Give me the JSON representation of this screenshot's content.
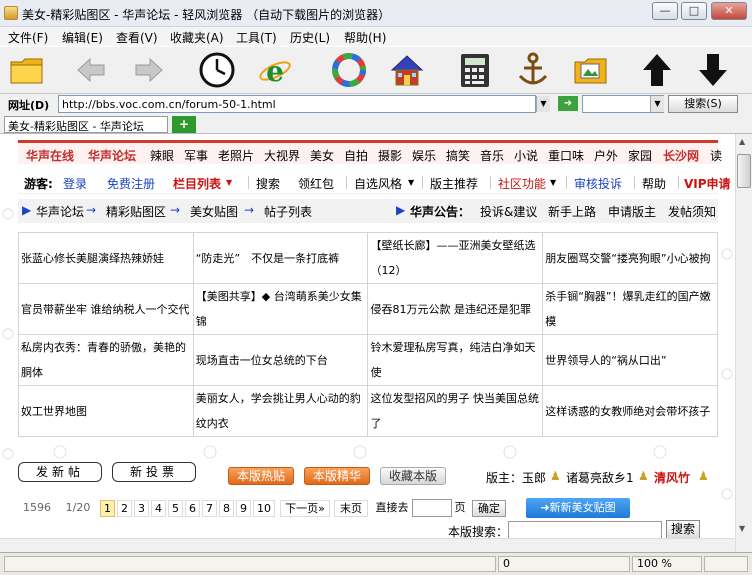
{
  "window": {
    "title": "美女-精彩贴图区 - 华声论坛 - 轻风浏览器 （自动下载图片的浏览器）",
    "controls": {
      "minimize": "—",
      "maximize": "□",
      "close": "✕"
    }
  },
  "menu": [
    "文件(F)",
    "编辑(E)",
    "查看(V)",
    "收藏夹(A)",
    "工具(T)",
    "历史(L)",
    "帮助(H)"
  ],
  "toolbar": {
    "buttons": [
      "folder-icon",
      "back-icon",
      "forward-icon",
      "clock-icon",
      "ie-icon",
      "refresh-ring-icon",
      "home-icon",
      "calculator-icon",
      "anchor-icon",
      "picture-folder-icon",
      "up-arrow-icon",
      "down-arrow-icon"
    ]
  },
  "address": {
    "label": "网址(D)",
    "url": "http://bbs.voc.com.cn/forum-50-1.html",
    "go": "➜",
    "search_button": "搜索(S)"
  },
  "tabs": {
    "active": "美女-精彩贴图区 - 华声论坛",
    "new_tab": "+"
  },
  "site_nav": [
    "华声在线",
    "华声论坛",
    "辣眼",
    "军事",
    "老照片",
    "大视界",
    "美女",
    "自拍",
    "摄影",
    "娱乐",
    "搞笑",
    "音乐",
    "小说",
    "重口味",
    "户外",
    "家园",
    "长沙网",
    "读"
  ],
  "guest_bar": {
    "label": "游客:",
    "login": "登录",
    "register": "免费注册",
    "column_list": "栏目列表",
    "items": [
      "搜索",
      "领红包",
      "自选风格",
      "版主推荐",
      "社区功能",
      "审核投诉",
      "帮助",
      "VIP申请"
    ]
  },
  "breadcrumb": {
    "items": [
      "华声论坛",
      "精彩贴图区",
      "美女贴图",
      "帖子列表"
    ],
    "arrow": "→",
    "announce_label": "华声公告：",
    "announce_links": [
      "投诉&建议",
      "新手上路",
      "申请版主",
      "发帖须知"
    ]
  },
  "posts": [
    [
      "张蓝心修长美腿演绎热辣娇娃",
      "“防走光”　不仅是一条打底裤",
      "【壁纸长廊】——亚洲美女壁纸选（12）",
      "朋友圈骂交警“搂亮狗眼”小心被拘"
    ],
    [
      "官员带薪坐牢 谁给纳税人一个交代",
      "【美图共享】◆ 台湾萌系美少女集锦",
      "侵吞81万元公款 是违纪还是犯罪",
      "杀手锏“胸器”！爆乳走红的国产嫩模"
    ],
    [
      "私房内衣秀：青春的骄傲，美艳的胴体",
      "现场直击一位女总统的下台",
      "铃木爱理私房写真，纯洁白净如天使",
      "世界领导人的“祸从口出”"
    ],
    [
      "奴工世界地图",
      "美丽女人，学会挑让男人心动的豹纹内衣",
      "这位发型招风的男子 快当美国总统了",
      "这样诱惑的女教师绝对会带坏孩子"
    ]
  ],
  "actions": {
    "new_post": "发新帖",
    "new_poll": "新投票",
    "hot": "本版热贴",
    "essence": "本版精华",
    "favorite": "收藏本版",
    "moderator_label": "版主：",
    "moderators": [
      "玉郎",
      "诸葛亮敌乡1",
      "清风竹"
    ]
  },
  "pager": {
    "total_posts": "1596",
    "page_info": "1/20",
    "pages": [
      "1",
      "2",
      "3",
      "4",
      "5",
      "6",
      "7",
      "8",
      "9",
      "10"
    ],
    "current": "1",
    "next": "下一页»",
    "last": "末页",
    "goto_label": "直接去",
    "page_unit": "页",
    "confirm": "确定",
    "new_beauty_post": "➜新新美女贴图"
  },
  "search": {
    "label": "本版搜索：",
    "button": "搜索"
  },
  "status": {
    "field1": "0",
    "zoom": "100 %"
  },
  "colors": {
    "brand_red": "#d23a2a",
    "link_blue": "#1c44c6",
    "orange": "#e06a1a"
  }
}
